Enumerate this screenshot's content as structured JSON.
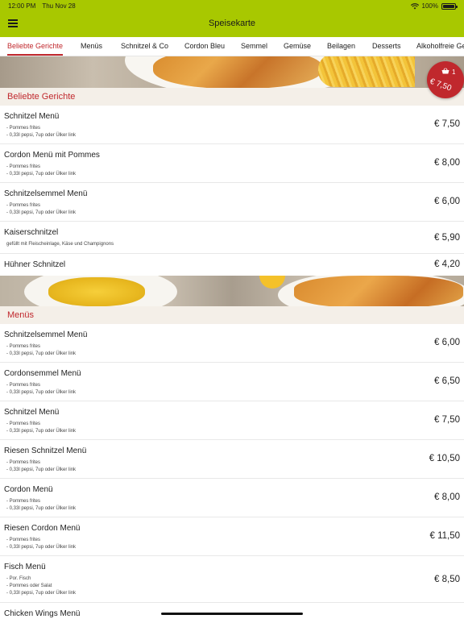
{
  "status": {
    "time": "12:00 PM",
    "date": "Thu Nov 28",
    "battery": "100%",
    "icons": [
      "wifi-icon",
      "battery-icon"
    ]
  },
  "nav": {
    "title": "Speisekarte",
    "menu_icon": "hamburger-menu-icon"
  },
  "tabs": [
    {
      "label": "Beliebte Gerichte",
      "active": true
    },
    {
      "label": "Menüs",
      "active": false
    },
    {
      "label": "Schnitzel & Co",
      "active": false
    },
    {
      "label": "Cordon Bleu",
      "active": false
    },
    {
      "label": "Semmel",
      "active": false
    },
    {
      "label": "Gemüse",
      "active": false
    },
    {
      "label": "Beilagen",
      "active": false
    },
    {
      "label": "Desserts",
      "active": false
    },
    {
      "label": "Alkoholfreie Ge",
      "active": false
    }
  ],
  "cart": {
    "icon": "basket-icon",
    "count": "1",
    "total": "€ 7,50"
  },
  "sections": [
    {
      "title": "Beliebte Gerichte",
      "items": [
        {
          "name": "Schnitzel Menü",
          "desc": [
            " - Pommes frites",
            " - 0,33l pepsi, 7up oder Ülker link"
          ],
          "price": "€ 7,50"
        },
        {
          "name": "Cordon Menü mit Pommes",
          "desc": [
            " - Pommes frites",
            " - 0,33l pepsi, 7up oder Ülker link"
          ],
          "price": "€ 8,00"
        },
        {
          "name": "Schnitzelsemmel Menü",
          "desc": [
            " - Pommes frites",
            " - 0,33l pepsi, 7up oder Ülker link"
          ],
          "price": "€ 6,00"
        },
        {
          "name": "Kaiserschnitzel",
          "desc": [
            "gefüllt mit Fleischeinlage, Käse und Champignons"
          ],
          "price": "€ 5,90"
        },
        {
          "name": "Hühner Schnitzel",
          "desc": [],
          "price": "€ 4,20"
        }
      ]
    },
    {
      "title": "Menüs",
      "items": [
        {
          "name": "Schnitzelsemmel Menü",
          "desc": [
            " - Pommes frites",
            " - 0,33l pepsi, 7up oder Ülker link"
          ],
          "price": "€ 6,00"
        },
        {
          "name": "Cordonsemmel  Menü",
          "desc": [
            " - Pommes frites",
            " - 0,33l pepsi, 7up oder Ülker link"
          ],
          "price": "€ 6,50"
        },
        {
          "name": "Schnitzel Menü",
          "desc": [
            " - Pommes frites",
            " - 0,33l pepsi, 7up oder Ülker link"
          ],
          "price": "€ 7,50"
        },
        {
          "name": "Riesen Schnitzel Menü",
          "desc": [
            " - Pommes frites",
            " - 0,33l pepsi, 7up oder Ülker link"
          ],
          "price": "€ 10,50"
        },
        {
          "name": "Cordon Menü",
          "desc": [
            " - Pommes frites",
            " - 0,33l pepsi, 7up oder Ülker link"
          ],
          "price": "€ 8,00"
        },
        {
          "name": "Riesen Cordon Menü",
          "desc": [
            " - Pommes frites",
            " - 0,33l pepsi, 7up oder Ülker link"
          ],
          "price": "€ 11,50"
        },
        {
          "name": "Fisch Menü",
          "desc": [
            " - Por. Fisch",
            " - Pommes oder Salat",
            " - 0,33l pepsi, 7up oder Ülker link"
          ],
          "price": "€ 8,50"
        },
        {
          "name": "Chicken Wings Menü",
          "desc": [],
          "price": ""
        }
      ]
    }
  ]
}
